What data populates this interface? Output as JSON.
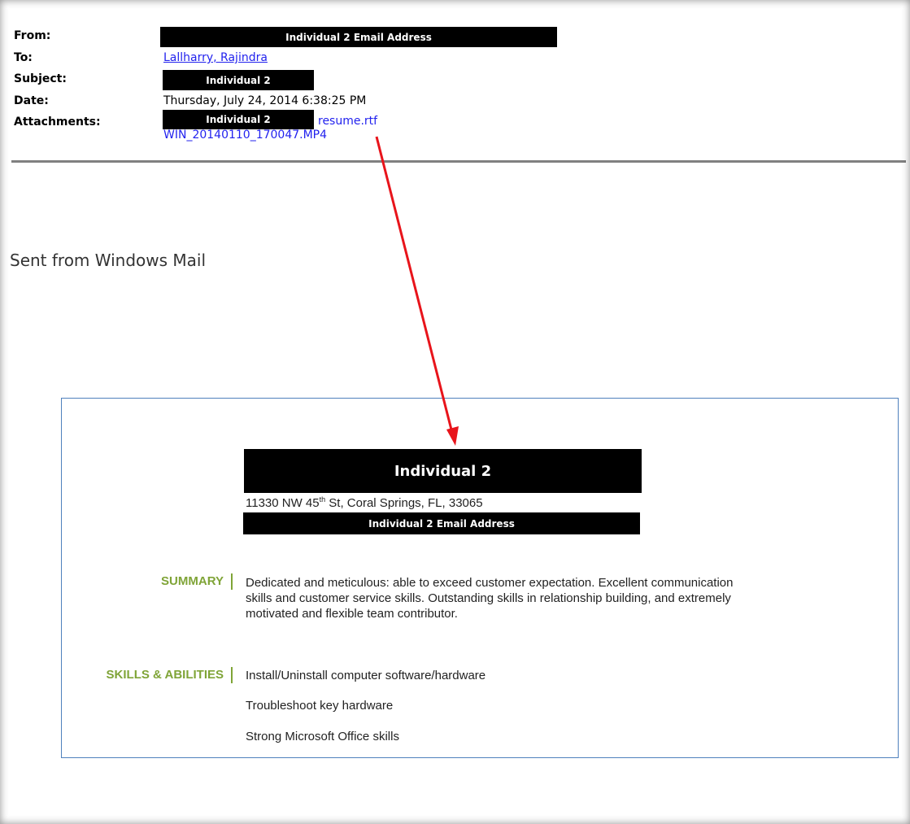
{
  "email": {
    "labels": {
      "from": "From:",
      "to": "To:",
      "subject": "Subject:",
      "date": "Date:",
      "attachments": "Attachments:"
    },
    "from_redaction": "Individual 2 Email Address",
    "to": "Lallharry, Rajindra",
    "subject_redaction": "Individual 2",
    "date": "Thursday, July 24, 2014 6:38:25 PM",
    "attachment_redaction": "Individual 2",
    "attachment_1": "resume.rtf",
    "attachment_2": "WIN_20140110_170047.MP4",
    "body": "Sent from Windows Mail"
  },
  "resume": {
    "name_redaction": "Individual 2",
    "address_prefix": "11330 NW 45",
    "address_sup": "th",
    "address_suffix": " St, Coral Springs, FL, 33065",
    "email_redaction": "Individual 2 Email Address",
    "summary_label": "SUMMARY",
    "summary_lines": [
      "Dedicated and meticulous: able to exceed customer expectation. Excellent communication",
      "skills and customer service skills. Outstanding skills in relationship building, and extremely",
      "motivated and flexible team contributor."
    ],
    "skills_label": "SKILLS & ABILITIES",
    "skills": [
      "Install/Uninstall computer software/hardware",
      "Troubleshoot key hardware",
      "Strong Microsoft Office skills"
    ]
  },
  "colors": {
    "section_accent": "#7fa437",
    "link": "#2222ee",
    "arrow": "#e8141b",
    "box_border": "#4f81bd"
  }
}
